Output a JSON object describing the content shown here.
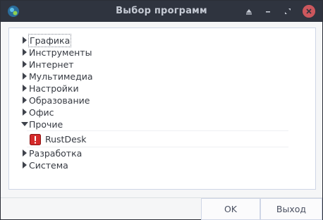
{
  "window": {
    "title": "Выбор программ"
  },
  "titlebar": {
    "app_icon": "app-icon",
    "up_icon": "triangle-up-icon",
    "minimize_icon": "minimize-icon",
    "restore_icon": "restore-icon",
    "close_icon": "close-icon"
  },
  "tree": {
    "items": [
      {
        "label": "Графика",
        "expanded": false
      },
      {
        "label": "Инструменты",
        "expanded": false
      },
      {
        "label": "Интернет",
        "expanded": false
      },
      {
        "label": "Мультимедиа",
        "expanded": false
      },
      {
        "label": "Настройки",
        "expanded": false
      },
      {
        "label": "Образование",
        "expanded": false
      },
      {
        "label": "Офис",
        "expanded": false
      },
      {
        "label": "Прочие",
        "expanded": true,
        "children": [
          {
            "label": "RustDesk",
            "icon": "warning-icon"
          }
        ]
      },
      {
        "label": "Разработка",
        "expanded": false
      },
      {
        "label": "Система",
        "expanded": false
      }
    ]
  },
  "buttons": {
    "ok": "OK",
    "exit": "Выход"
  },
  "colors": {
    "titlebar": "#2f343f",
    "close": "#cc575d",
    "warning": "#d42a2a",
    "border": "#cfd6e6"
  }
}
